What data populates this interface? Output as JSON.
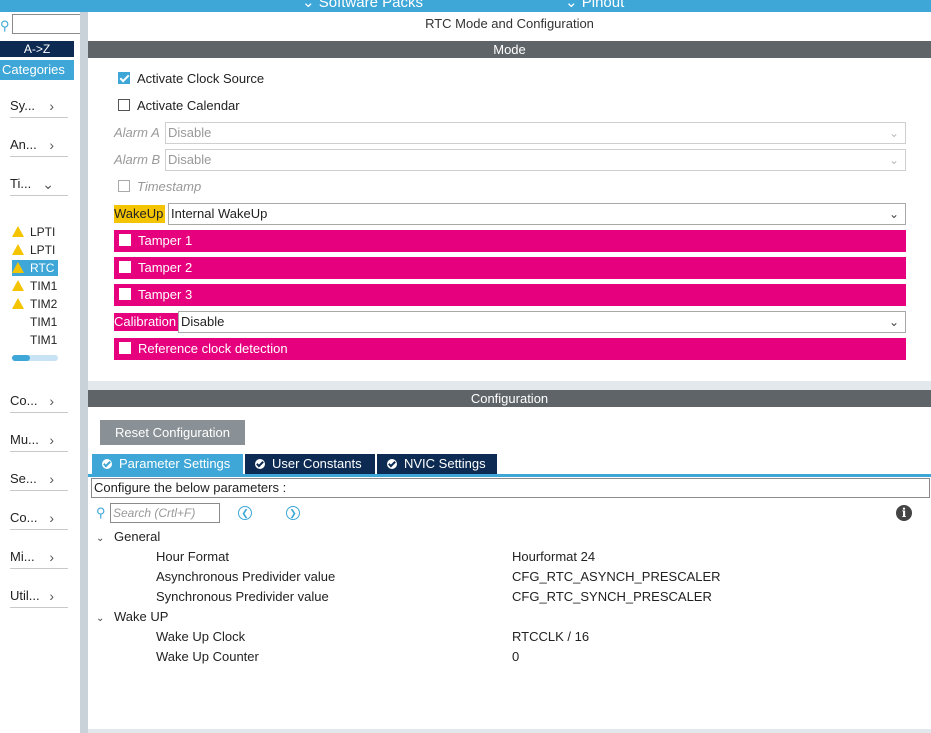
{
  "topbar": {
    "left_label": "Software Packs",
    "right_label": "Pinout"
  },
  "sidebar": {
    "sort_button": "A->Z",
    "categories_tab": "Categories",
    "categories": [
      {
        "label": "Sy...",
        "chevron": ">"
      },
      {
        "label": "An...",
        "chevron": ">"
      },
      {
        "label": "Ti...",
        "chevron": "v"
      }
    ],
    "peripherals": [
      {
        "label": "LPTI",
        "warning": true,
        "selected": false
      },
      {
        "label": "LPTI",
        "warning": true,
        "selected": false
      },
      {
        "label": "RTC",
        "warning": true,
        "selected": true
      },
      {
        "label": "TIM1",
        "warning": true,
        "selected": false
      },
      {
        "label": "TIM2",
        "warning": true,
        "selected": false
      },
      {
        "label": "TIM1",
        "warning": false,
        "selected": false
      },
      {
        "label": "TIM1",
        "warning": false,
        "selected": false
      }
    ],
    "scroll_position": 0.4,
    "categories_bottom": [
      {
        "label": "Co...",
        "chevron": ">"
      },
      {
        "label": "Mu...",
        "chevron": ">"
      },
      {
        "label": "Se...",
        "chevron": ">"
      },
      {
        "label": "Co...",
        "chevron": ">"
      },
      {
        "label": "Mi...",
        "chevron": ">"
      },
      {
        "label": "Util...",
        "chevron": ">"
      }
    ]
  },
  "panel_title": "RTC Mode and Configuration",
  "mode": {
    "header": "Mode",
    "activate_clock_source": {
      "label": "Activate Clock Source",
      "checked": true
    },
    "activate_calendar": {
      "label": "Activate Calendar",
      "checked": false
    },
    "alarm_a": {
      "label": "Alarm A",
      "value": "Disable"
    },
    "alarm_b": {
      "label": "Alarm B",
      "value": "Disable"
    },
    "timestamp": {
      "label": "Timestamp",
      "checked": false
    },
    "wakeup": {
      "label": "WakeUp",
      "value": "Internal WakeUp"
    },
    "tamper1": "Tamper 1",
    "tamper2": "Tamper 2",
    "tamper3": "Tamper 3",
    "calibration": {
      "label": "Calibration",
      "value": "Disable"
    },
    "reference_clock": "Reference clock detection"
  },
  "configuration": {
    "header": "Configuration",
    "reset_button": "Reset Configuration",
    "tabs": [
      "Parameter Settings",
      "User Constants",
      "NVIC Settings"
    ],
    "instructions": "Configure the below parameters :",
    "search_placeholder": "Search (Crtl+F)",
    "groups": [
      {
        "name": "General",
        "params": [
          {
            "name": "Hour Format",
            "value": "Hourformat 24"
          },
          {
            "name": "Asynchronous Predivider value",
            "value": "CFG_RTC_ASYNCH_PRESCALER"
          },
          {
            "name": "Synchronous Predivider value",
            "value": "CFG_RTC_SYNCH_PRESCALER"
          }
        ]
      },
      {
        "name": "Wake UP",
        "params": [
          {
            "name": "Wake Up Clock",
            "value": "RTCCLK / 16"
          },
          {
            "name": "Wake Up Counter",
            "value": "0"
          }
        ]
      }
    ]
  },
  "colors": {
    "accent_blue": "#3ea7d8",
    "navy": "#0d2b52",
    "pink": "#e6007e",
    "yellow_highlight": "#f5c400",
    "header_gray": "#5f6468"
  }
}
